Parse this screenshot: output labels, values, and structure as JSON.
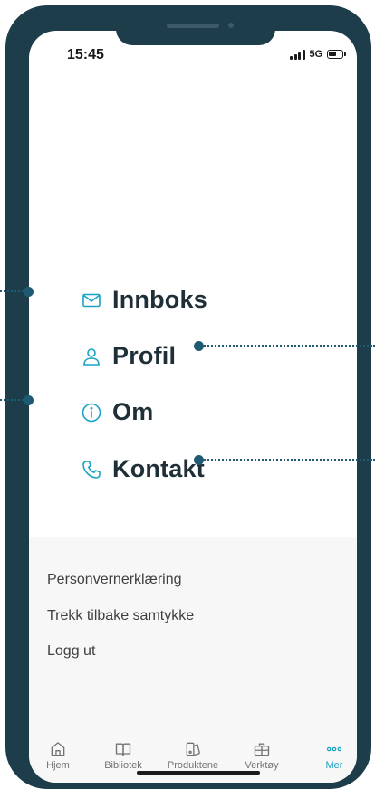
{
  "status_bar": {
    "time": "15:45",
    "network": "5G"
  },
  "menu": [
    {
      "label": "Innboks",
      "icon": "mail-icon"
    },
    {
      "label": "Profil",
      "icon": "user-icon"
    },
    {
      "label": "Om",
      "icon": "info-icon"
    },
    {
      "label": "Kontakt",
      "icon": "phone-icon"
    }
  ],
  "secondary_links": [
    "Personvernerklæring",
    "Trekk tilbake samtykke",
    "Logg ut"
  ],
  "tabs": [
    {
      "label": "Hjem",
      "icon": "home-icon"
    },
    {
      "label": "Bibliotek",
      "icon": "book-icon"
    },
    {
      "label": "Produktene",
      "icon": "products-icon"
    },
    {
      "label": "Verktøy",
      "icon": "toolbox-icon"
    },
    {
      "label": "Mer",
      "icon": "more-icon",
      "active": true
    }
  ],
  "colors": {
    "accent": "#19a3c4",
    "frame": "#1e3d4b",
    "text_dark": "#1f2f38",
    "annotation": "#1e5b72"
  }
}
